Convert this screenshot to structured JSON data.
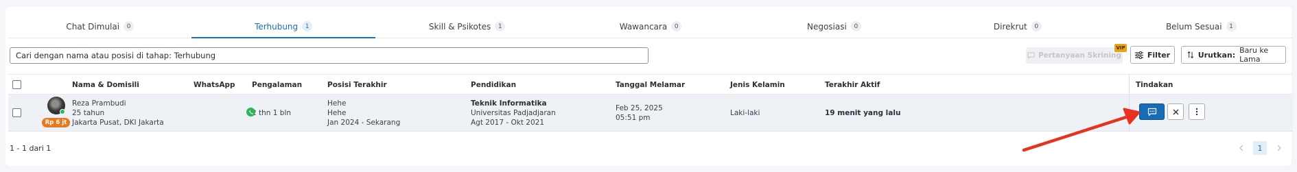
{
  "tabs": [
    {
      "label": "Chat Dimulai",
      "count": "0"
    },
    {
      "label": "Terhubung",
      "count": "1"
    },
    {
      "label": "Skill & Psikotes",
      "count": "1"
    },
    {
      "label": "Wawancara",
      "count": "0"
    },
    {
      "label": "Negosiasi",
      "count": "0"
    },
    {
      "label": "Direkrut",
      "count": "0"
    },
    {
      "label": "Belum Sesuai",
      "count": "1"
    }
  ],
  "toolbar": {
    "search_value": "Cari dengan nama atau posisi di tahap: Terhubung",
    "screening_label": "Pertanyaan Skrining",
    "vip_label": "VIP",
    "filter_label": "Filter",
    "sort_label": "Urutkan:",
    "sort_value": "Baru ke Lama"
  },
  "table": {
    "headers": {
      "name": "Nama & Domisili",
      "whatsapp": "WhatsApp",
      "experience": "Pengalaman",
      "last_position": "Posisi Terakhir",
      "education": "Pendidikan",
      "applied_date": "Tanggal Melamar",
      "gender": "Jenis Kelamin",
      "last_active": "Terakhir Aktif",
      "actions": "Tindakan"
    },
    "rows": [
      {
        "name": "Reza Prambudi",
        "age": "25 tahun",
        "location": "Jakarta Pusat, DKI Jakarta",
        "salary": "Rp 6 jt",
        "experience": "2 thn 1 bln",
        "position_line1": "Hehe",
        "position_line2": "Hehe",
        "position_period": "Jan 2024 - Sekarang",
        "education_major": "Teknik Informatika",
        "education_school": "Universitas Padjadjaran",
        "education_period": "Agt 2017 - Okt 2021",
        "applied_date": "Feb 25, 2025",
        "applied_time": "05:51 pm",
        "gender": "Laki-laki",
        "last_active": "19 menit yang lalu"
      }
    ]
  },
  "footer": {
    "range_text": "1 - 1 dari 1",
    "current_page": "1"
  },
  "colors": {
    "accent": "#1a6ec0",
    "chat_button": "#176cb8",
    "salary_badge": "#e8791f",
    "whatsapp": "#2fb45a",
    "annotation_arrow": "#e8321e",
    "vip": "#e8a317"
  }
}
